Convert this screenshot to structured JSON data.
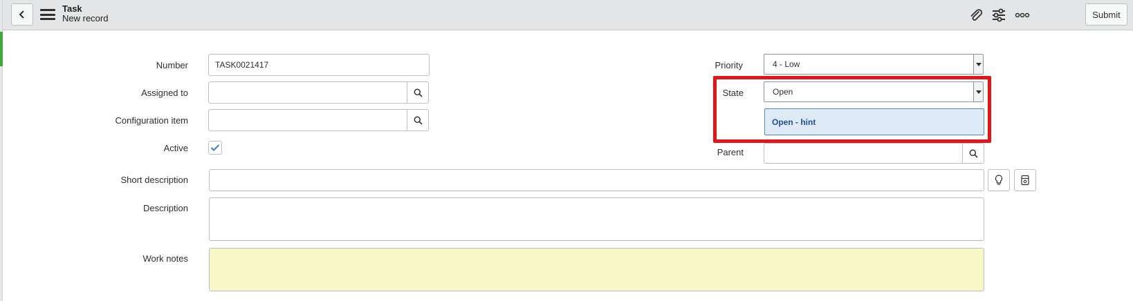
{
  "header": {
    "title": "Task",
    "subtitle": "New record",
    "submit_label": "Submit"
  },
  "form": {
    "number": {
      "label": "Number",
      "value": "TASK0021417"
    },
    "assigned_to": {
      "label": "Assigned to",
      "value": ""
    },
    "configuration_item": {
      "label": "Configuration item",
      "value": ""
    },
    "active": {
      "label": "Active",
      "checked": true
    },
    "priority": {
      "label": "Priority",
      "value": "4 - Low"
    },
    "state": {
      "label": "State",
      "value": "Open",
      "dropdown_option": "Open - hint"
    },
    "parent": {
      "label": "Parent",
      "value": ""
    },
    "short_description": {
      "label": "Short description",
      "value": ""
    },
    "description": {
      "label": "Description",
      "value": ""
    },
    "work_notes": {
      "label": "Work notes",
      "value": ""
    }
  },
  "icons": {
    "back": "chevron-left-icon",
    "menu": "hamburger-menu-icon",
    "attachment": "paperclip-icon",
    "personalize": "sliders-icon",
    "more": "more-options-icon",
    "search": "search-icon",
    "suggestion": "lightbulb-icon",
    "template": "template-icon"
  },
  "colors": {
    "header_bg": "#e3e5e6",
    "work_notes_bg": "#f9f7c8",
    "highlight": "#e0161b",
    "option_bg": "#dfeaf7",
    "option_text": "#1f4ea0"
  }
}
